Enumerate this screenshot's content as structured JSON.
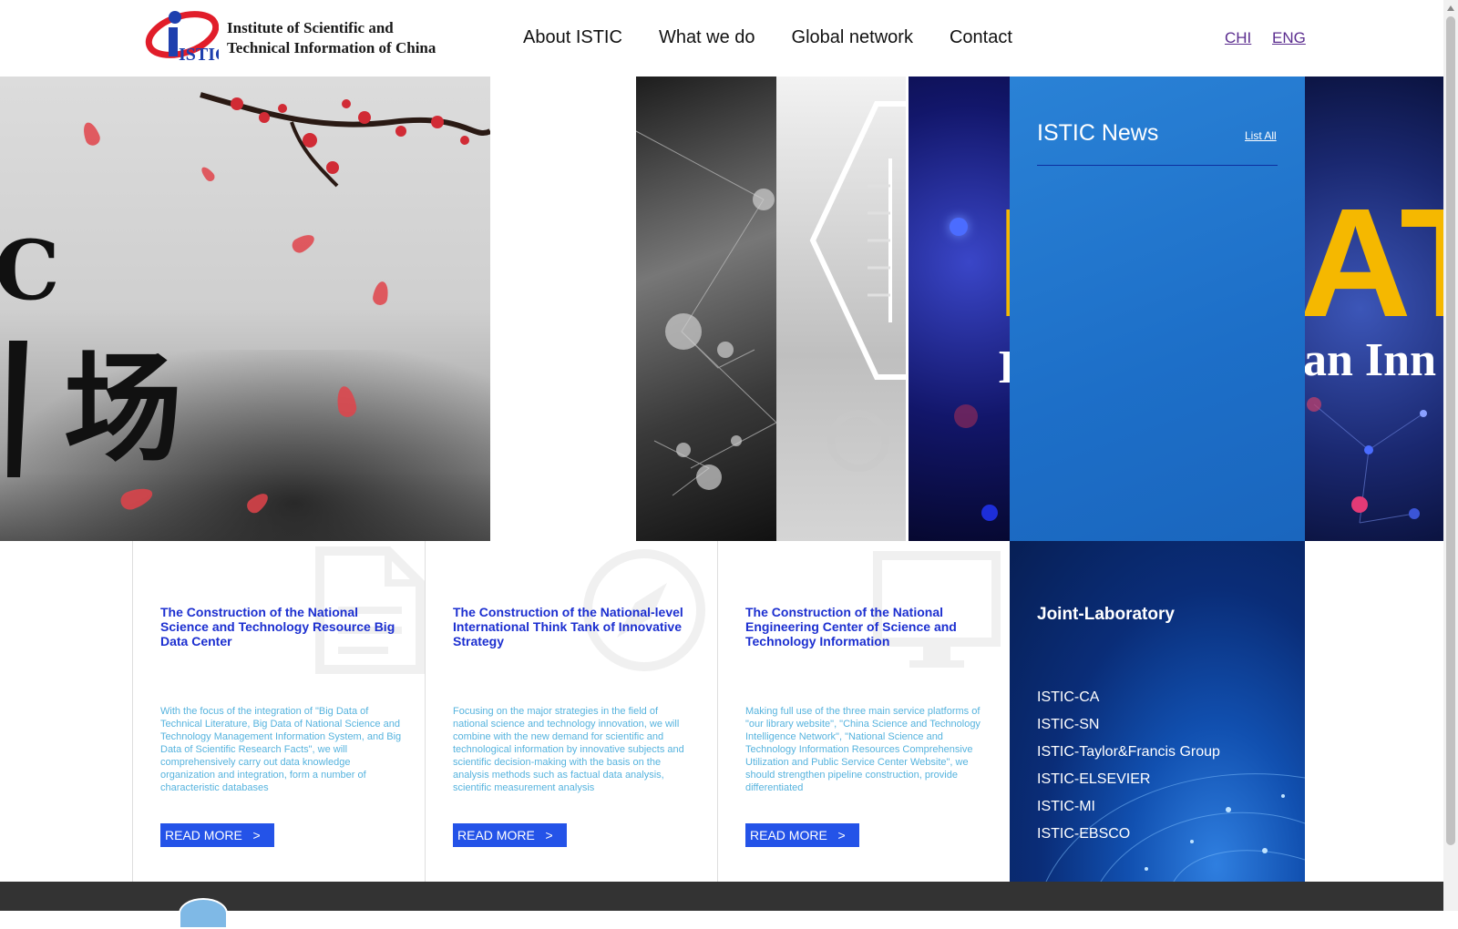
{
  "header": {
    "logo_text_line1": "Institute of Scientific and",
    "logo_text_line2": "Technical Information of China",
    "logo_mark": "ISTIC",
    "nav": [
      "About ISTIC",
      "What we do",
      "Global network",
      "Contact"
    ],
    "lang_chi": "CHI",
    "lang_eng": "ENG"
  },
  "hero": {
    "ink_chars": [
      "C",
      "场"
    ],
    "big_letters_a": "I",
    "big_letters_b": "ATA",
    "white_text_a": "I",
    "white_text_b": "an Inn"
  },
  "news": {
    "title": "ISTIC News",
    "list_all": "List All"
  },
  "cards": [
    {
      "title": "The Construction of the National Science and Technology Resource Big Data Center",
      "description": "With the focus of the integration of \"Big Data of Technical Literature, Big Data of National Science and Technology Management Information System, and Big Data of Scientific Research Facts\", we will comprehensively carry out data knowledge organization and integration, form a number of characteristic databases",
      "button": "READ MORE   >",
      "icon": "document-icon"
    },
    {
      "title": "The Construction of the National-level International Think Tank of Innovative Strategy",
      "description": "Focusing on the major strategies in the field of national science and technology innovation, we will combine with the new demand for scientific and technological information by innovative subjects and scientific decision-making with the basis on the analysis methods such as factual data analysis, scientific measurement analysis",
      "button": "READ MORE   >",
      "icon": "compass-icon"
    },
    {
      "title": "The Construction of the National Engineering Center of Science and Technology Information",
      "description": "Making full use of the three main service platforms of \"our library website\", \"China Science and Technology Intelligence Network\", \"National Science and Technology Information Resources Comprehensive Utilization and Public Service Center Website\", we should strengthen pipeline construction, provide differentiated",
      "button": "READ MORE   >",
      "icon": "monitor-icon"
    }
  ],
  "joint_lab": {
    "title": "Joint-Laboratory",
    "items": [
      "ISTIC-CA",
      "ISTIC-SN",
      "ISTIC-Taylor&Francis Group",
      "ISTIC-ELSEVIER",
      "ISTIC-MI",
      "ISTIC-EBSCO"
    ]
  },
  "colors": {
    "brand_blue": "#2453e8",
    "news_blue": "#1d6fc8",
    "card_title": "#1c2fd0",
    "card_desc": "#56b3de",
    "footer": "#333333"
  }
}
